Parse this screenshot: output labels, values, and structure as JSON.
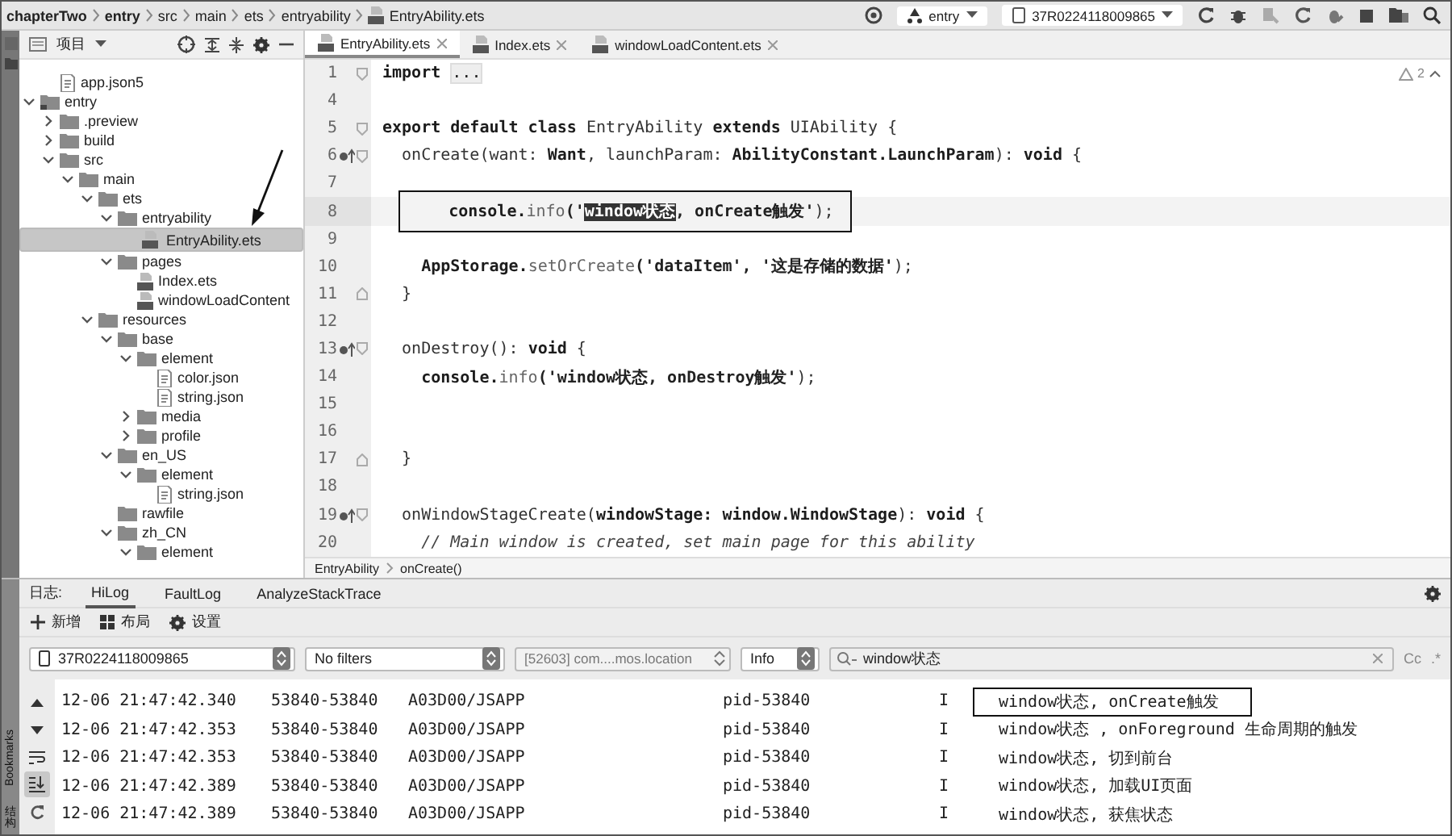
{
  "breadcrumb": [
    "chapterTwo",
    "entry",
    "src",
    "main",
    "ets",
    "entryability",
    "EntryAbility.ets"
  ],
  "run_config": "entry",
  "device": "37R0224118009865",
  "project_panel": {
    "title": "项目"
  },
  "tree": {
    "items": [
      {
        "children": [
          {
            "label": "app.json5",
            "kind": "json",
            "selected": false
          }
        ]
      },
      {
        "label": "entry",
        "kind": "module",
        "expanded": true,
        "selected": false,
        "children": [
          {
            "label": ".preview",
            "kind": "folder",
            "expanded": false,
            "selected": false
          },
          {
            "label": "build",
            "kind": "folder",
            "expanded": false,
            "selected": false
          },
          {
            "label": "src",
            "kind": "folder",
            "expanded": true,
            "selected": false,
            "children": [
              {
                "label": "main",
                "kind": "folder",
                "expanded": true,
                "selected": false,
                "children": [
                  {
                    "label": "ets",
                    "kind": "folder",
                    "expanded": true,
                    "selected": false,
                    "children": [
                      {
                        "label": "entryability",
                        "kind": "folder",
                        "expanded": true,
                        "selected": false,
                        "children": [
                          {
                            "label": "EntryAbility.ets",
                            "kind": "ets",
                            "selected": true
                          }
                        ]
                      },
                      {
                        "label": "pages",
                        "kind": "folder",
                        "expanded": true,
                        "selected": false,
                        "children": [
                          {
                            "label": "Index.ets",
                            "kind": "ets",
                            "selected": false
                          },
                          {
                            "label": "windowLoadContent",
                            "kind": "ets",
                            "selected": false
                          }
                        ]
                      }
                    ]
                  },
                  {
                    "label": "resources",
                    "kind": "folder",
                    "expanded": true,
                    "selected": false,
                    "children": [
                      {
                        "label": "base",
                        "kind": "folder",
                        "expanded": true,
                        "selected": false,
                        "children": [
                          {
                            "label": "element",
                            "kind": "folder",
                            "expanded": true,
                            "selected": false,
                            "children": [
                              {
                                "label": "color.json",
                                "kind": "json",
                                "selected": false
                              },
                              {
                                "label": "string.json",
                                "kind": "json",
                                "selected": false
                              }
                            ]
                          },
                          {
                            "label": "media",
                            "kind": "folder",
                            "expanded": false,
                            "selected": false
                          },
                          {
                            "label": "profile",
                            "kind": "folder",
                            "expanded": false,
                            "selected": false
                          }
                        ]
                      },
                      {
                        "label": "en_US",
                        "kind": "folder",
                        "expanded": true,
                        "selected": false,
                        "children": [
                          {
                            "label": "element",
                            "kind": "folder",
                            "expanded": true,
                            "selected": false,
                            "children": [
                              {
                                "label": "string.json",
                                "kind": "json",
                                "selected": false
                              }
                            ]
                          }
                        ]
                      },
                      {
                        "label": "rawfile",
                        "kind": "folder",
                        "selected": false
                      },
                      {
                        "label": "zh_CN",
                        "kind": "folder",
                        "expanded": true,
                        "selected": false,
                        "children": [
                          {
                            "label": "element",
                            "kind": "folder",
                            "expanded": true,
                            "selected": false
                          }
                        ]
                      }
                    ]
                  }
                ]
              }
            ]
          }
        ]
      }
    ]
  },
  "editor_tabs": [
    {
      "label": "EntryAbility.ets",
      "selected": true
    },
    {
      "label": "Index.ets",
      "selected": false
    },
    {
      "label": "windowLoadContent.ets",
      "selected": false
    }
  ],
  "warnings": "2",
  "code": [
    {
      "number": "1",
      "kind": "fold-start",
      "override": false,
      "current": false,
      "boxed": false,
      "segments": [
        {
          "text": "import ",
          "kind": "kw"
        },
        {
          "text": "...",
          "kind": "folded"
        }
      ]
    },
    {
      "number": "4",
      "kind": "plain",
      "override": false,
      "current": false,
      "boxed": false
    },
    {
      "number": "5",
      "kind": "fold-start",
      "override": false,
      "current": false,
      "boxed": false,
      "segments": [
        {
          "text": "export default class ",
          "kind": "kw"
        },
        {
          "text": "EntryAbility ",
          "kind": "plain"
        },
        {
          "text": "extends ",
          "kind": "kw"
        },
        {
          "text": "UIAbility {",
          "kind": "plain"
        }
      ]
    },
    {
      "number": "6",
      "kind": "fold-start",
      "override": true,
      "current": false,
      "boxed": false,
      "segments": [
        {
          "text": "  onCreate(want: ",
          "kind": "plain"
        },
        {
          "text": "Want",
          "kind": "kw"
        },
        {
          "text": ", launchParam: ",
          "kind": "plain"
        },
        {
          "text": "AbilityConstant.LaunchParam",
          "kind": "kw"
        },
        {
          "text": "): ",
          "kind": "plain"
        },
        {
          "text": "void",
          "kind": "kw"
        },
        {
          "text": " {",
          "kind": "plain"
        }
      ]
    },
    {
      "number": "7",
      "kind": "plain",
      "override": false,
      "current": false,
      "boxed": false
    },
    {
      "number": "8",
      "kind": "plain",
      "override": false,
      "current": true,
      "boxed": true,
      "segments": [
        {
          "text": "    console.",
          "kind": "kw"
        },
        {
          "text": "info",
          "kind": "call"
        },
        {
          "text": "('",
          "kind": "str"
        },
        {
          "text": "window状态",
          "kind": "match"
        },
        {
          "text": ", onCreate触发'",
          "kind": "str"
        },
        {
          "text": ");",
          "kind": "plain"
        }
      ]
    },
    {
      "number": "9",
      "kind": "plain",
      "override": false,
      "current": false,
      "boxed": false
    },
    {
      "number": "10",
      "kind": "plain",
      "override": false,
      "current": false,
      "boxed": false,
      "segments": [
        {
          "text": "    AppStorage.",
          "kind": "kw"
        },
        {
          "text": "setOrCreate",
          "kind": "call"
        },
        {
          "text": "('dataItem', '这是存储的数据'",
          "kind": "str"
        },
        {
          "text": ");",
          "kind": "plain"
        }
      ]
    },
    {
      "number": "11",
      "kind": "fold-end",
      "override": false,
      "current": false,
      "boxed": false,
      "segments": [
        {
          "text": "  }",
          "kind": "plain"
        }
      ]
    },
    {
      "number": "12",
      "kind": "plain",
      "override": false,
      "current": false,
      "boxed": false
    },
    {
      "number": "13",
      "kind": "fold-start",
      "override": true,
      "current": false,
      "boxed": false,
      "segments": [
        {
          "text": "  onDestroy(): ",
          "kind": "plain"
        },
        {
          "text": "void",
          "kind": "kw"
        },
        {
          "text": " {",
          "kind": "plain"
        }
      ]
    },
    {
      "number": "14",
      "kind": "plain",
      "override": false,
      "current": false,
      "boxed": false,
      "segments": [
        {
          "text": "    console.",
          "kind": "kw"
        },
        {
          "text": "info",
          "kind": "call"
        },
        {
          "text": "('window状态, onDestroy触发'",
          "kind": "str"
        },
        {
          "text": ");",
          "kind": "plain"
        }
      ]
    },
    {
      "number": "15",
      "kind": "plain",
      "override": false,
      "current": false,
      "boxed": false
    },
    {
      "number": "16",
      "kind": "plain",
      "override": false,
      "current": false,
      "boxed": false
    },
    {
      "number": "17",
      "kind": "fold-end",
      "override": false,
      "current": false,
      "boxed": false,
      "segments": [
        {
          "text": "  }",
          "kind": "plain"
        }
      ]
    },
    {
      "number": "18",
      "kind": "plain",
      "override": false,
      "current": false,
      "boxed": false
    },
    {
      "number": "19",
      "kind": "fold-start",
      "override": true,
      "current": false,
      "boxed": false,
      "segments": [
        {
          "text": "  onWindowStageCreate(",
          "kind": "plain"
        },
        {
          "text": "windowStage: window.WindowStage",
          "kind": "kw"
        },
        {
          "text": "): ",
          "kind": "plain"
        },
        {
          "text": "void",
          "kind": "kw"
        },
        {
          "text": " {",
          "kind": "plain"
        }
      ]
    },
    {
      "number": "20",
      "kind": "plain",
      "override": false,
      "current": false,
      "boxed": false,
      "segments": [
        {
          "text": "    // Main window is created, set main page for this ability",
          "kind": "comment"
        }
      ]
    }
  ],
  "editor_breadcrumb": [
    "EntryAbility",
    "onCreate()"
  ],
  "log_panel": {
    "label": "日志:",
    "tabs": [
      {
        "label": "HiLog",
        "selected": true
      },
      {
        "label": "FaultLog",
        "selected": false
      },
      {
        "label": "AnalyzeStackTrace",
        "selected": false
      }
    ],
    "actions": [
      {
        "label": "新增",
        "kind": "plus"
      },
      {
        "label": "布局",
        "kind": "grid"
      },
      {
        "label": "设置",
        "kind": "gear"
      }
    ],
    "device": "37R0224118009865",
    "filter": "No filters",
    "process": "[52603] com....mos.location",
    "level": "Info",
    "search": "window状态",
    "case_toggle": "Cc",
    "regex_toggle": ".*",
    "side_buttons": [
      {
        "kind": "up",
        "selected": false
      },
      {
        "kind": "down",
        "selected": false
      },
      {
        "kind": "wrap",
        "selected": false
      },
      {
        "kind": "scroll-end",
        "selected": true
      },
      {
        "kind": "restart",
        "selected": false
      }
    ],
    "rows": [
      {
        "time": "12-06 21:47:42.340",
        "pid": "53840-53840",
        "tag": "A03D00/JSAPP",
        "process": "pid-53840",
        "level": "I",
        "message": "window状态, onCreate触发",
        "boxed": true
      },
      {
        "time": "12-06 21:47:42.353",
        "pid": "53840-53840",
        "tag": "A03D00/JSAPP",
        "process": "pid-53840",
        "level": "I",
        "message": "window状态 , onForeground 生命周期的触发",
        "boxed": false
      },
      {
        "time": "12-06 21:47:42.353",
        "pid": "53840-53840",
        "tag": "A03D00/JSAPP",
        "process": "pid-53840",
        "level": "I",
        "message": "window状态, 切到前台",
        "boxed": false
      },
      {
        "time": "12-06 21:47:42.389",
        "pid": "53840-53840",
        "tag": "A03D00/JSAPP",
        "process": "pid-53840",
        "level": "I",
        "message": "window状态, 加载UI页面",
        "boxed": false
      },
      {
        "time": "12-06 21:47:42.389",
        "pid": "53840-53840",
        "tag": "A03D00/JSAPP",
        "process": "pid-53840",
        "level": "I",
        "message": "window状态, 获焦状态",
        "boxed": false
      }
    ]
  },
  "side_tools": [
    {
      "label": "Bookmarks",
      "kind": "rotated"
    },
    {
      "label": "结构",
      "kind": "stacked"
    }
  ]
}
